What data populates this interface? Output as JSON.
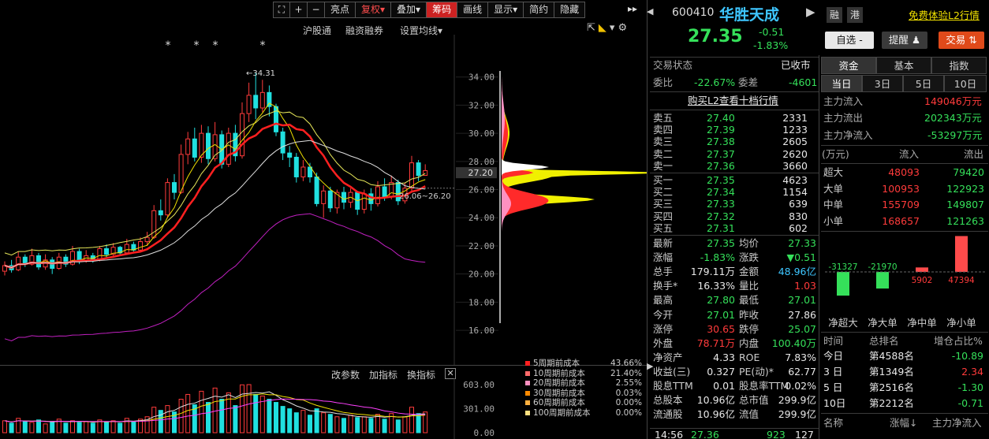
{
  "toolbar": {
    "buttons": [
      {
        "label": "",
        "name": "fullscreen-button"
      },
      {
        "label": "+",
        "name": "zoom-in-button"
      },
      {
        "label": "−",
        "name": "zoom-out-button"
      },
      {
        "label": "亮点",
        "name": "highlight-button"
      },
      {
        "label": "复权▾",
        "name": "adjust-button"
      },
      {
        "label": "叠加▾",
        "name": "overlay-button"
      },
      {
        "label": "筹码",
        "name": "chips-button"
      },
      {
        "label": "画线",
        "name": "draw-line-button"
      },
      {
        "label": "显示▾",
        "name": "display-button"
      },
      {
        "label": "简约",
        "name": "simple-button"
      },
      {
        "label": "隐藏",
        "name": "hide-button"
      }
    ]
  },
  "chart_header": {
    "links": [
      "沪股通",
      "融资融券",
      "设置均线▾"
    ],
    "price_marker": "34.31",
    "ma_label": "26.06~26.20",
    "stars": "*",
    "chip_price": "27.20"
  },
  "chart_data": {
    "type": "candlestick",
    "ylim": [
      15.5,
      36
    ],
    "y_ticks": [
      "34.00",
      "32.00",
      "30.00",
      "28.00",
      "26.00",
      "24.00",
      "22.00",
      "20.00",
      "18.00",
      "16.00"
    ],
    "volume_ticks": [
      "603.00",
      "301.00",
      "0.00"
    ],
    "volume_max": 603
  },
  "indicator_bar": {
    "buttons": [
      "改参数",
      "加指标",
      "换指标"
    ]
  },
  "chip_legend": [
    {
      "label": "5周期前成本",
      "value": "43.66%",
      "color": "#ff2020"
    },
    {
      "label": "10周期前成本",
      "value": "21.40%",
      "color": "#ff6a6a"
    },
    {
      "label": "20周期前成本",
      "value": "2.55%",
      "color": "#ff90c0"
    },
    {
      "label": "30周期前成本",
      "value": "0.03%",
      "color": "#ff8a00"
    },
    {
      "label": "60周期前成本",
      "value": "0.00%",
      "color": "#ffb040"
    },
    {
      "label": "100周期前成本",
      "value": "0.00%",
      "color": "#ffe080"
    }
  ],
  "stock": {
    "code": "600410",
    "name": "华胜天成",
    "tag1": "融",
    "tag2": "港",
    "promo": "免费体验L2行情",
    "price": "27.35",
    "change": "-0.51",
    "change_pct": "-1.83%",
    "btn_watch": "自选 -",
    "btn_alert": "提醒",
    "btn_trade": "交易"
  },
  "status": {
    "label": "交易状态",
    "value": "已收市",
    "wb_label": "委比",
    "wb_value": "-22.67%",
    "wc_label": "委差",
    "wc_value": "-4601",
    "buy_l2": "购买L2查看十档行情"
  },
  "orderbook": {
    "sells": [
      {
        "label": "卖五",
        "price": "27.40",
        "vol": "2331"
      },
      {
        "label": "卖四",
        "price": "27.39",
        "vol": "1233"
      },
      {
        "label": "卖三",
        "price": "27.38",
        "vol": "2605"
      },
      {
        "label": "卖二",
        "price": "27.37",
        "vol": "2620"
      },
      {
        "label": "卖一",
        "price": "27.36",
        "vol": "3660"
      }
    ],
    "buys": [
      {
        "label": "买一",
        "price": "27.35",
        "vol": "4623"
      },
      {
        "label": "买二",
        "price": "27.34",
        "vol": "1154"
      },
      {
        "label": "买三",
        "price": "27.33",
        "vol": "639"
      },
      {
        "label": "买四",
        "price": "27.32",
        "vol": "830"
      },
      {
        "label": "买五",
        "price": "27.31",
        "vol": "602"
      }
    ]
  },
  "quote": [
    {
      "l1": "最新",
      "v1": "27.35",
      "c1": "green",
      "l2": "均价",
      "v2": "27.33",
      "c2": "green"
    },
    {
      "l1": "涨幅",
      "v1": "-1.83%",
      "c1": "green",
      "l2": "涨跌",
      "v2": "▼0.51",
      "c2": "green"
    },
    {
      "l1": "总手",
      "v1": "179.11万",
      "c1": "white",
      "l2": "金额",
      "v2": "48.96亿",
      "c2": "cyan"
    },
    {
      "l1": "换手*",
      "v1": "16.33%",
      "c1": "white",
      "l2": "量比",
      "v2": "1.03",
      "c2": "red"
    },
    {
      "l1": "最高",
      "v1": "27.80",
      "c1": "green",
      "l2": "最低",
      "v2": "27.01",
      "c2": "green"
    },
    {
      "l1": "今开",
      "v1": "27.01",
      "c1": "green",
      "l2": "昨收",
      "v2": "27.86",
      "c2": "white"
    },
    {
      "l1": "涨停",
      "v1": "30.65",
      "c1": "red",
      "l2": "跌停",
      "v2": "25.07",
      "c2": "green"
    },
    {
      "l1": "外盘",
      "v1": "78.71万",
      "c1": "red",
      "l2": "内盘",
      "v2": "100.40万",
      "c2": "green"
    },
    {
      "l1": "净资产",
      "v1": "4.33",
      "c1": "white",
      "l2": "ROE",
      "v2": "7.83%",
      "c2": "white"
    },
    {
      "l1": "收益(三)",
      "v1": "0.327",
      "c1": "white",
      "l2": "PE(动)*",
      "v2": "62.77",
      "c2": "white"
    },
    {
      "l1": "股息TTM",
      "v1": "0.01",
      "c1": "white",
      "l2": "股息率TTM",
      "v2": "0.02%",
      "c2": "white"
    },
    {
      "l1": "总股本",
      "v1": "10.96亿",
      "c1": "white",
      "l2": "总市值",
      "v2": "299.9亿",
      "c2": "white"
    },
    {
      "l1": "流通股",
      "v1": "10.96亿",
      "c1": "white",
      "l2": "流值",
      "v2": "299.9亿",
      "c2": "white"
    }
  ],
  "tick": {
    "time": "14:56",
    "price": "27.36",
    "vol": "923",
    "num": "127"
  },
  "fund": {
    "tabs": [
      "资金",
      "基本",
      "指数"
    ],
    "periods": [
      "当日",
      "3日",
      "5日",
      "10日"
    ],
    "main_in_label": "主力流入",
    "main_in": "149046万元",
    "main_out_label": "主力流出",
    "main_out": "202343万元",
    "main_net_label": "主力净流入",
    "main_net": "-53297万元",
    "unit": "(万元)",
    "col_in": "流入",
    "col_out": "流出",
    "rows": [
      {
        "label": "超大",
        "in": "48093",
        "out": "79420"
      },
      {
        "label": "大单",
        "in": "100953",
        "out": "122923"
      },
      {
        "label": "中单",
        "in": "155709",
        "out": "149807"
      },
      {
        "label": "小单",
        "in": "168657",
        "out": "121263"
      }
    ],
    "net_bars": [
      {
        "label": "净超大",
        "value": -31327,
        "text": "-31327"
      },
      {
        "label": "净大单",
        "value": -21970,
        "text": "-21970"
      },
      {
        "label": "净中单",
        "value": 5902,
        "text": "5902"
      },
      {
        "label": "净小单",
        "value": 47394,
        "text": "47394"
      }
    ],
    "rank_header": [
      "时间",
      "总排名",
      "增仓占比%"
    ],
    "ranks": [
      {
        "t": "今日",
        "r": "第4588名",
        "v": "-10.89",
        "c": "green"
      },
      {
        "t": "3 日",
        "r": "第1349名",
        "v": "2.34",
        "c": "red"
      },
      {
        "t": "5 日",
        "r": "第2516名",
        "v": "-1.30",
        "c": "green"
      },
      {
        "t": "10日",
        "r": "第2212名",
        "v": "-0.71",
        "c": "green"
      }
    ],
    "bottom_header": [
      "名称",
      "涨幅↓",
      "主力净流入"
    ]
  }
}
